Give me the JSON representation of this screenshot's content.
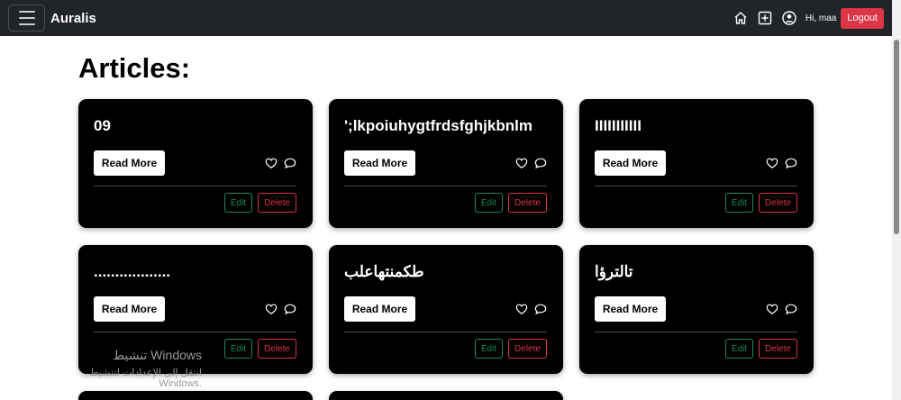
{
  "navbar": {
    "brand": "Auralis",
    "greeting": "Hi, maa",
    "logout_label": "Logout",
    "icons": [
      "home-icon",
      "plus-square-icon",
      "user-circle-icon"
    ]
  },
  "page": {
    "title": "Articles:"
  },
  "cards": [
    {
      "title": "09",
      "read_more": "Read More",
      "edit": "Edit",
      "delete": "Delete"
    },
    {
      "title": "';lkpoiuhygtfrdsfghjkbnlm",
      "read_more": "Read More",
      "edit": "Edit",
      "delete": "Delete"
    },
    {
      "title": "IIIIIIIIIII",
      "read_more": "Read More",
      "edit": "Edit",
      "delete": "Delete"
    },
    {
      "title": "..................",
      "read_more": "Read More",
      "edit": "Edit",
      "delete": "Delete"
    },
    {
      "title": "طكمنتهاعلب",
      "read_more": "Read More",
      "edit": "Edit",
      "delete": "Delete"
    },
    {
      "title": "تالترؤا",
      "read_more": "Read More",
      "edit": "Edit",
      "delete": "Delete"
    }
  ],
  "watermark": {
    "title": "تنشيط Windows",
    "subtitle": "انتقل إلى الإعدادات لتنشيط Windows."
  },
  "colors": {
    "navbar_bg": "#212529",
    "logout": "#dc3545",
    "edit": "#198754",
    "delete": "#dc3545",
    "card_bg": "#000000"
  }
}
